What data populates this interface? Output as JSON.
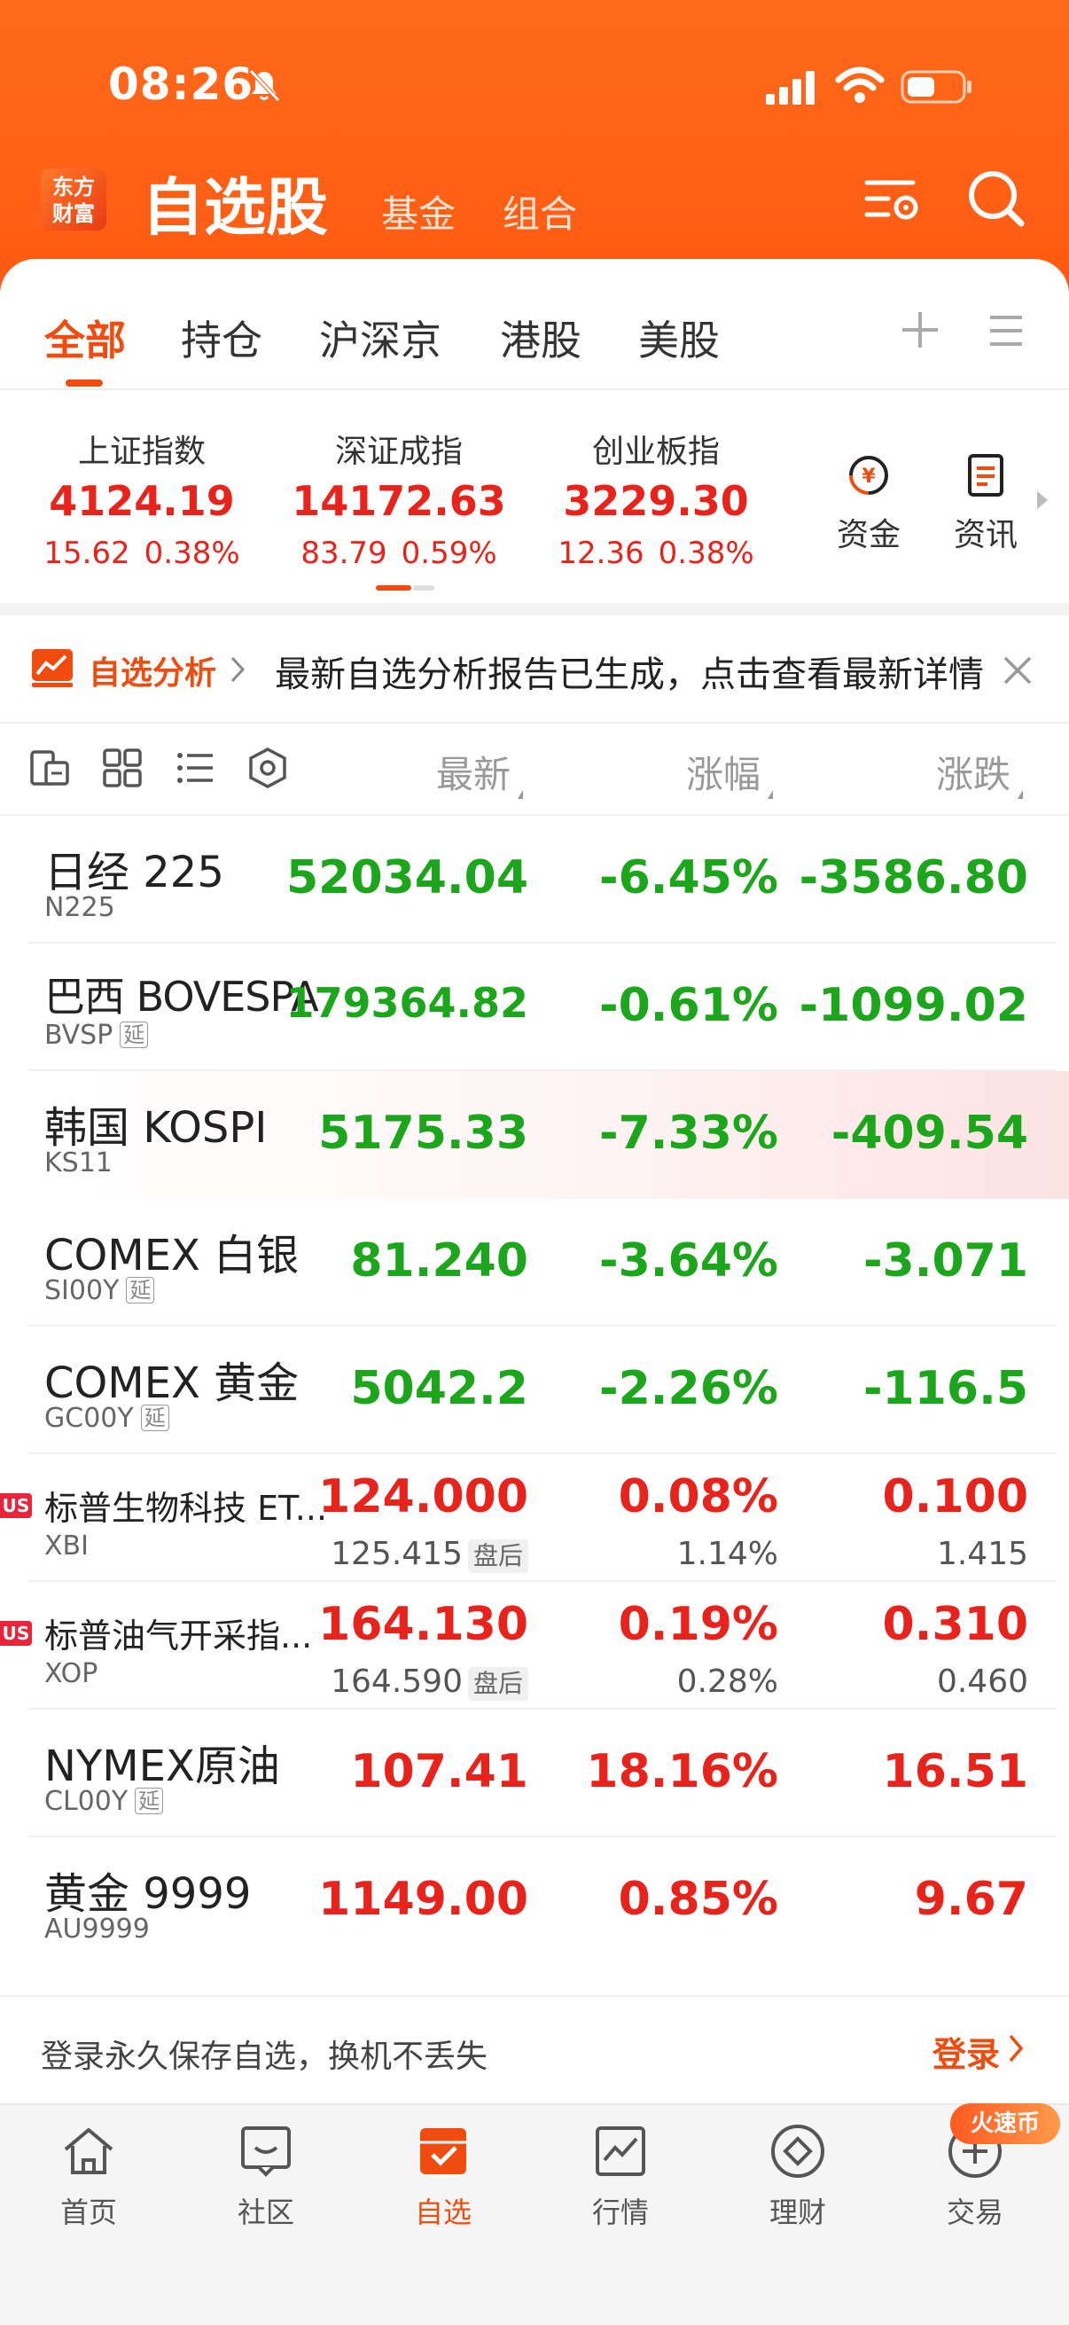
{
  "status_bar": {
    "time": "08:26"
  },
  "header": {
    "logo_line1": "东方",
    "logo_line2": "财富",
    "title": "自选股",
    "subtabs": [
      "基金",
      "组合"
    ]
  },
  "tabs": [
    "全部",
    "持仓",
    "沪深京",
    "港股",
    "美股"
  ],
  "indices": [
    {
      "name": "上证指数",
      "value": "4124.19",
      "change": "15.62",
      "percent": "0.38%"
    },
    {
      "name": "深证成指",
      "value": "14172.63",
      "change": "83.79",
      "percent": "0.59%"
    },
    {
      "name": "创业板指",
      "value": "3229.30",
      "change": "12.36",
      "percent": "0.38%"
    }
  ],
  "quick_links": [
    {
      "label": "资金",
      "icon": "yuan-coin-icon"
    },
    {
      "label": "资讯",
      "icon": "news-doc-icon"
    }
  ],
  "banner": {
    "tag": "自选分析",
    "text": "最新自选分析报告已生成，点击查看最新详情"
  },
  "columns": {
    "latest": "最新",
    "change_pct": "涨幅",
    "change": "涨跌"
  },
  "rows": [
    {
      "name": "日经 225",
      "code": "N225",
      "delayed": false,
      "price": "52034.04",
      "pct": "-6.45%",
      "diff": "-3586.80",
      "color": "green"
    },
    {
      "name": "巴西 BOVESPA",
      "code": "BVSP",
      "delayed": true,
      "price": "179364.82",
      "pct": "-0.61%",
      "diff": "-1099.02",
      "color": "green"
    },
    {
      "name": "韩国 KOSPI",
      "code": "KS11",
      "delayed": false,
      "price": "5175.33",
      "pct": "-7.33%",
      "diff": "-409.54",
      "color": "green"
    },
    {
      "name": "COMEX 白银",
      "code": "SI00Y",
      "delayed": true,
      "price": "81.240",
      "pct": "-3.64%",
      "diff": "-3.071",
      "color": "green"
    },
    {
      "name": "COMEX 黄金",
      "code": "GC00Y",
      "delayed": true,
      "price": "5042.2",
      "pct": "-2.26%",
      "diff": "-116.5",
      "color": "green"
    },
    {
      "name": "标普生物科技 ET...",
      "code": "XBI",
      "badge": "US",
      "price": "124.000",
      "pct": "0.08%",
      "diff": "0.100",
      "color": "red",
      "after_price": "125.415",
      "after_tag": "盘后",
      "after_pct": "1.14%",
      "after_diff": "1.415"
    },
    {
      "name": "标普油气开采指...",
      "code": "XOP",
      "badge": "US",
      "price": "164.130",
      "pct": "0.19%",
      "diff": "0.310",
      "color": "red",
      "after_price": "164.590",
      "after_tag": "盘后",
      "after_pct": "0.28%",
      "after_diff": "0.460"
    },
    {
      "name": "NYMEX原油",
      "code": "CL00Y",
      "delayed": true,
      "price": "107.41",
      "pct": "18.16%",
      "diff": "16.51",
      "color": "red"
    },
    {
      "name": "黄金 9999",
      "code": "AU9999",
      "delayed": false,
      "price": "1149.00",
      "pct": "0.85%",
      "diff": "9.67",
      "color": "red"
    }
  ],
  "delay_label": "延",
  "login": {
    "text": "登录永久保存自选，换机不丢失",
    "button": "登录"
  },
  "bottom_nav": [
    {
      "label": "首页",
      "icon": "home-icon"
    },
    {
      "label": "社区",
      "icon": "community-icon"
    },
    {
      "label": "自选",
      "icon": "watchlist-icon",
      "active": true
    },
    {
      "label": "行情",
      "icon": "market-chart-icon"
    },
    {
      "label": "理财",
      "icon": "wealth-diamond-icon"
    },
    {
      "label": "交易",
      "icon": "trade-plus-icon"
    }
  ],
  "fire_badge": "火速币",
  "colors": {
    "brand": "#f04c10",
    "up": "#e8231b",
    "down": "#1ba61b"
  }
}
